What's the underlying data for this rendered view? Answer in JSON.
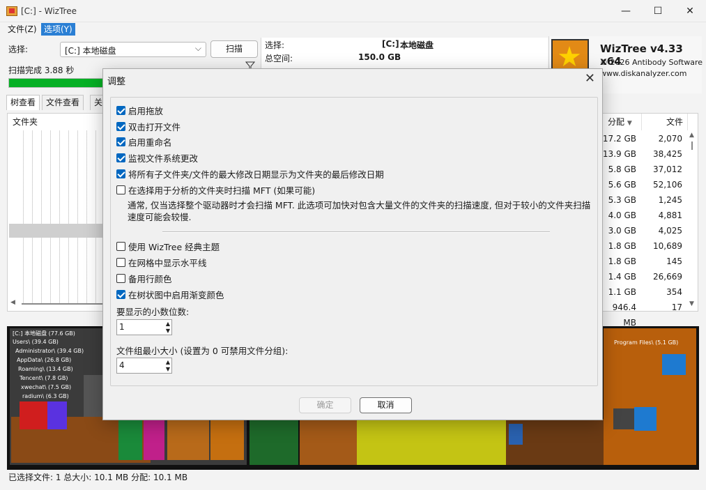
{
  "window": {
    "title": "[C:]  - WizTree",
    "minimize": "—",
    "maximize": "☐",
    "close": "✕"
  },
  "menu": {
    "file": "文件(Z)",
    "options": "选项(Y)"
  },
  "scan": {
    "select_label": "选择:",
    "drive_value": "[C:] 本地磁盘",
    "scan_button": "扫描",
    "scan_done": "扫描完成 3.88 秒",
    "filter_icon": "filter-icon",
    "progress": 1.0
  },
  "drive_info": {
    "select_label": "选择:",
    "drive_tag": "[C:]",
    "drive_name": "本地磁盘",
    "total_label": "总空间:",
    "total_value": "150.0 GB"
  },
  "brand": {
    "name": "WizTree v4.33 x64",
    "copyright": "© 2026 Antibody Software",
    "url": "www.diskanalyzer.com"
  },
  "tabs": [
    "树查看",
    "文件查看",
    "关"
  ],
  "tree": {
    "folder_header": "文件夹",
    "alloc_header": "分配",
    "files_header": "文件",
    "rows": [
      {
        "alloc": "17.2 GB",
        "files": "2,070"
      },
      {
        "alloc": "13.9 GB",
        "files": "38,425"
      },
      {
        "alloc": "5.8 GB",
        "files": "37,012"
      },
      {
        "alloc": "5.6 GB",
        "files": "52,106"
      },
      {
        "alloc": "5.3 GB",
        "files": "1,245"
      },
      {
        "alloc": "4.0 GB",
        "files": "4,881"
      },
      {
        "alloc": "3.0 GB",
        "files": "4,025"
      },
      {
        "alloc": "1.8 GB",
        "files": "10,689"
      },
      {
        "alloc": "1.8 GB",
        "files": "145"
      },
      {
        "alloc": "1.4 GB",
        "files": "26,669"
      },
      {
        "alloc": "1.1 GB",
        "files": "354"
      },
      {
        "alloc": "946.4 MB",
        "files": "17"
      }
    ]
  },
  "treemap": {
    "labels": [
      "[C:] 本地磁盘  (77.6 GB)",
      "Users\\ (39.4 GB)",
      "Administrator\\ (39.4 GB)",
      "AppData\\ (26.8 GB)",
      "Roaming\\ (13.4 GB)",
      "Tencent\\ (7.8 GB)",
      "xwechat\\ (7.5 GB)",
      "radium\\ (6.3 GB)"
    ],
    "right_label": "Program Files\\ (5.1 GB)"
  },
  "status": "已选择文件: 1  总大小: 10.1 MB  分配: 10.1 MB",
  "dialog": {
    "title": "调整",
    "close": "✕",
    "options": [
      {
        "label": "启用拖放",
        "checked": true
      },
      {
        "label": "双击打开文件",
        "checked": true
      },
      {
        "label": "启用重命名",
        "checked": true
      },
      {
        "label": "监视文件系统更改",
        "checked": true
      },
      {
        "label": "将所有子文件夹/文件的最大修改日期显示为文件夹的最后修改日期",
        "checked": true
      },
      {
        "label": "在选择用于分析的文件夹时扫描 MFT (如果可能)",
        "checked": false
      }
    ],
    "hint": "通常, 仅当选择整个驱动器时才会扫描 MFT. 此选项可加快对包含大量文件的文件夹的扫描速度, 但对于较小的文件夹扫描速度可能会较慢.",
    "options2": [
      {
        "label": "使用 WizTree 经典主题",
        "checked": false
      },
      {
        "label": "在网格中显示水平线",
        "checked": false
      },
      {
        "label": "备用行颜色",
        "checked": false
      },
      {
        "label": "在树状图中启用渐变颜色",
        "checked": true
      }
    ],
    "decimals_label": "要显示的小数位数:",
    "decimals_value": "1",
    "group_label": "文件组最小大小 (设置为 0 可禁用文件分组):",
    "group_value": "4",
    "ok": "确定",
    "cancel": "取消"
  }
}
